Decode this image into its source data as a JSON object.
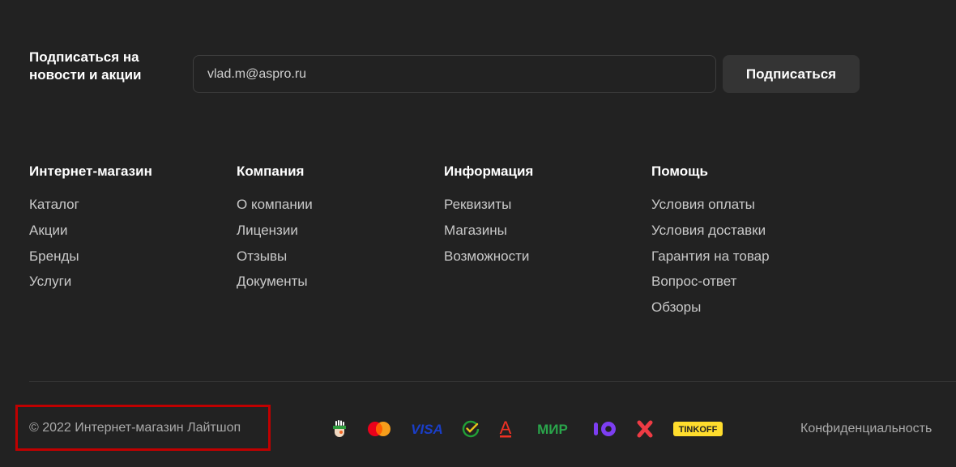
{
  "subscribe": {
    "title": "Подписаться на новости и акции",
    "email_value": "vlad.m@aspro.ru",
    "button_label": "Подписаться"
  },
  "columns": [
    {
      "title": "Интернет-магазин",
      "links": [
        "Каталог",
        "Акции",
        "Бренды",
        "Услуги"
      ]
    },
    {
      "title": "Компания",
      "links": [
        "О компании",
        "Лицензии",
        "Отзывы",
        "Документы"
      ]
    },
    {
      "title": "Информация",
      "links": [
        "Реквизиты",
        "Магазины",
        "Возможности"
      ]
    },
    {
      "title": "Помощь",
      "links": [
        "Условия оплаты",
        "Условия доставки",
        "Гарантия на товар",
        "Вопрос-ответ",
        "Обзоры"
      ]
    }
  ],
  "footer": {
    "copyright": "© 2022 Интернет-магазин Лайтшоп",
    "privacy_label": "Конфиденциальность",
    "payment_methods": [
      {
        "name": "qiwi-icon"
      },
      {
        "name": "mastercard-icon"
      },
      {
        "name": "visa-icon",
        "text": "VISA"
      },
      {
        "name": "sberpay-icon"
      },
      {
        "name": "alfabank-icon",
        "text": "А"
      },
      {
        "name": "mir-icon",
        "text": "МИР"
      },
      {
        "name": "yoomoney-icon"
      },
      {
        "name": "halva-icon"
      },
      {
        "name": "tinkoff-icon",
        "text": "TINKOFF"
      }
    ]
  },
  "colors": {
    "background": "#222222",
    "highlight_border": "#c00000",
    "visa": "#1a3ec8",
    "mastercard_red": "#eb001b",
    "mastercard_orange": "#f79e1b",
    "sber_green": "#21a038",
    "alfa_red": "#ef3124",
    "mir_green": "#2aa54b",
    "yoomoney_purple": "#7d3ef2",
    "halva_red": "#ee3b44",
    "tinkoff_yellow": "#ffdd2d"
  }
}
